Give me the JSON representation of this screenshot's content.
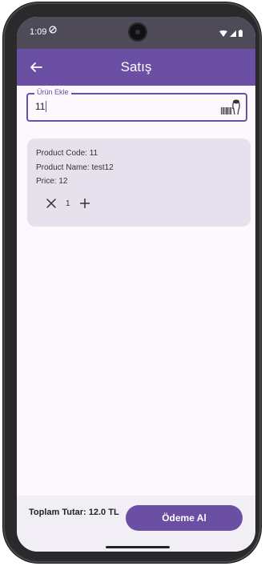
{
  "status_bar": {
    "time": "1:09",
    "alarm_icon": "do-not-disturb-icon",
    "wifi_icon": "wifi-icon",
    "signal_icon": "signal-icon",
    "battery_icon": "battery-icon"
  },
  "app_bar": {
    "back_icon": "back-arrow-icon",
    "title": "Satış"
  },
  "product_input": {
    "label": "Ürün Ekle",
    "value": "11",
    "scan_icon": "barcode-scanner-icon"
  },
  "cart": {
    "items": [
      {
        "code_line": "Product Code: 11",
        "name_line": "Product Name: test12",
        "price_line": "Price: 12",
        "quantity": "1",
        "remove_icon": "close-icon",
        "add_icon": "plus-icon"
      }
    ]
  },
  "footer": {
    "total": "Toplam Tutar: 12.0 TL",
    "pay_button": "Ödeme Al"
  },
  "colors": {
    "primary": "#6a4fa4",
    "status_bar": "#4e4a58",
    "card_bg": "#e7e1ee",
    "screen_bg": "#fcf8fd"
  }
}
